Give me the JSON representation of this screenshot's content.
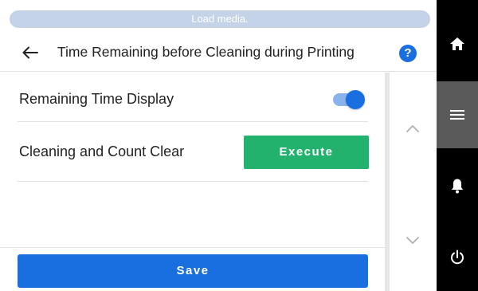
{
  "status": {
    "message": "Load media."
  },
  "header": {
    "title": "Time Remaining before Cleaning during Printing",
    "help_label": "?"
  },
  "settings": {
    "remaining_time_display": {
      "label": "Remaining Time Display",
      "enabled": true
    },
    "cleaning_count_clear": {
      "label": "Cleaning and Count Clear",
      "button_label": "Execute"
    }
  },
  "footer": {
    "save_label": "Save"
  },
  "nav_rail": {
    "items": [
      {
        "icon": "home-icon"
      },
      {
        "icon": "menu-icon",
        "selected": true
      },
      {
        "icon": "bell-icon"
      },
      {
        "icon": "power-icon"
      }
    ]
  },
  "colors": {
    "primary_blue": "#1a6fe0",
    "execute_green": "#23b26d",
    "status_pill": "#c5d3e8",
    "nav_rail_bg": "#000000",
    "nav_selected_bg": "#5a5a5a"
  }
}
